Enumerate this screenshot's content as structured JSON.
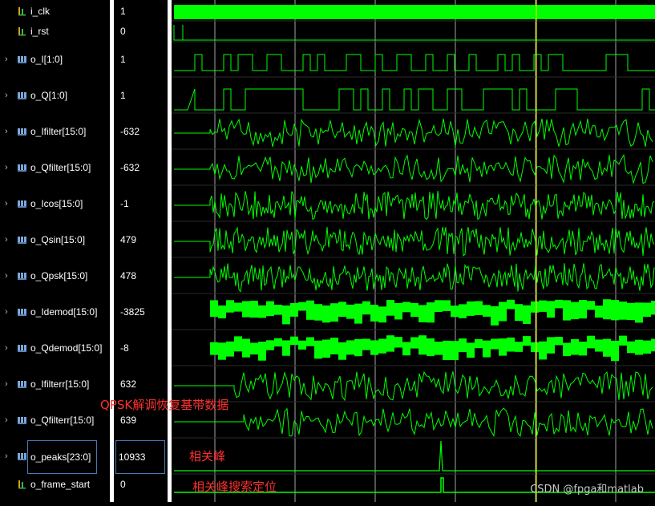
{
  "signals": [
    {
      "name": "i_clk",
      "value": "1",
      "expandable": false,
      "type": "bit"
    },
    {
      "name": "i_rst",
      "value": "0",
      "expandable": false,
      "type": "bit"
    },
    {
      "name": "o_I[1:0]",
      "value": "1",
      "expandable": true,
      "type": "bus"
    },
    {
      "name": "o_Q[1:0]",
      "value": "1",
      "expandable": true,
      "type": "bus"
    },
    {
      "name": "o_Ifilter[15:0]",
      "value": "-632",
      "expandable": true,
      "type": "bus"
    },
    {
      "name": "o_Qfilter[15:0]",
      "value": "-632",
      "expandable": true,
      "type": "bus"
    },
    {
      "name": "o_Icos[15:0]",
      "value": "-1",
      "expandable": true,
      "type": "bus"
    },
    {
      "name": "o_Qsin[15:0]",
      "value": "479",
      "expandable": true,
      "type": "bus"
    },
    {
      "name": "o_Qpsk[15:0]",
      "value": "478",
      "expandable": true,
      "type": "bus"
    },
    {
      "name": "o_Idemod[15:0]",
      "value": "-3825",
      "expandable": true,
      "type": "bus"
    },
    {
      "name": "o_Qdemod[15:0]",
      "value": "-8",
      "expandable": true,
      "type": "bus"
    },
    {
      "name": "o_Ifilterr[15:0]",
      "value": "632",
      "expandable": true,
      "type": "bus"
    },
    {
      "name": "o_Qfilterr[15:0]",
      "value": "639",
      "expandable": true,
      "type": "bus"
    },
    {
      "name": "o_peaks[23:0]",
      "value": "10933",
      "expandable": true,
      "type": "bus"
    },
    {
      "name": "o_frame_start",
      "value": "0",
      "expandable": false,
      "type": "bit"
    }
  ],
  "annotations": {
    "demod": "QPSK解调恢复基带数据",
    "peaks": "相关峰",
    "search": "相关峰搜索定位"
  },
  "watermark": "CSDN @fpga和matlab",
  "colors": {
    "wave": "#00ff00",
    "cursor": "#ffff00",
    "annotation": "#ff3030",
    "separator": "#ffffff"
  }
}
